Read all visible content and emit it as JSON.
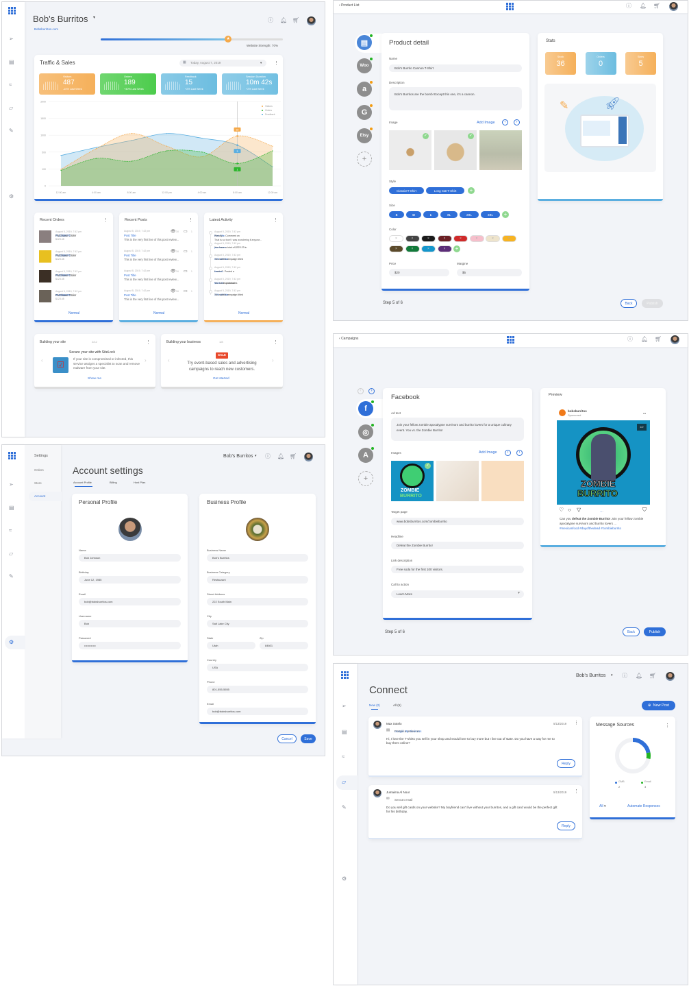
{
  "colors": {
    "accent": "#2f6fd8",
    "visitors": "#f5a94a",
    "orders": "#2db52d",
    "feedback": "#5aaee0",
    "online": "#22b322",
    "pending": "#f39c12"
  },
  "dashboard": {
    "brand": "Bob's Burritos",
    "brand_caret": "▾",
    "site_link": "Bobsburritos.com",
    "website_strength_label": "Website Strength: 70%",
    "website_strength": 0.7,
    "header_icons": [
      "info-icon",
      "bell-icon",
      "cart-icon",
      "avatar"
    ],
    "sidebar_icons": [
      "apps-grid-icon",
      "send-icon",
      "store-icon",
      "analytics-icon",
      "chat-icon",
      "pen-icon",
      "gear-icon"
    ],
    "traffic": {
      "title": "Traffic & Sales",
      "date": "Today, August 7, 2019",
      "stats": [
        {
          "label": "Visitors",
          "value": "487",
          "change": "-10% Last Week",
          "color": "#f5b05a"
        },
        {
          "label": "Orders",
          "value": "189",
          "change": "+40% Last Week",
          "color": "#4ccc4c"
        },
        {
          "label": "Feedback",
          "value": "15",
          "change": "+2% Last Week",
          "color": "#6cbde0"
        },
        {
          "label": "Session Duration",
          "value": "10m 42s",
          "change": "+2% Last Week",
          "color": "#72c0e2"
        }
      ]
    },
    "recent_orders": {
      "title": "Recent Orders",
      "footer": "Normal",
      "items": [
        {
          "date": "August 5, 2019, 7:42 pm",
          "label": "Purchase Order ",
          "order": "#12345678",
          "amount": "$123.45"
        },
        {
          "date": "August 5, 2019, 7:42 pm",
          "label": "Purchase Order ",
          "order": "#12345678",
          "amount": "$123.45"
        },
        {
          "date": "August 5, 2019, 7:42 pm",
          "label": "Purchase Order ",
          "order": "#12345678",
          "amount": "$123.45"
        },
        {
          "date": "August 5, 2019, 7:42 pm",
          "label": "Purchase Order ",
          "order": "#12345678",
          "amount": "$123.45"
        }
      ]
    },
    "recent_posts": {
      "title": "Recent Posts",
      "footer": "Normal",
      "items": [
        {
          "date": "August 5, 2019, 7:42 pm",
          "title": "Post Title",
          "excerpt": "This is the very first line of this post review...",
          "views": "34",
          "comments": "1"
        },
        {
          "date": "August 5, 2019, 7:42 pm",
          "title": "Post Title",
          "excerpt": "This is the very first line of this post review...",
          "views": "34",
          "comments": "1"
        },
        {
          "date": "August 5, 2019, 7:42 pm",
          "title": "Post Title",
          "excerpt": "This is the very first line of this post review...",
          "views": "34",
          "comments": "1"
        },
        {
          "date": "August 5, 2019, 7:42 pm",
          "title": "Post Title",
          "excerpt": "This is the very first line of this post review...",
          "views": "34",
          "comments": "1"
        }
      ]
    },
    "latest_activity": {
      "title": "Latest Activity",
      "footer": "Normal",
      "items": [
        {
          "date": "August 5, 2019, 7:42 pm",
          "text": "Wendy L. Comment on ",
          "link": "Post Title",
          "after": "",
          "extra": "That is so true! I was wondering if anyone..."
        },
        {
          "date": "August 5, 2019, 7:42 pm",
          "text": "You have a total of $323.23 in ",
          "link": "purchases",
          "after": "",
          "extra": ""
        },
        {
          "date": "August 5, 2019, 7:42 pm",
          "text": "You stated campaign titled ",
          "link": "25% off Sale",
          "after": "",
          "extra": ""
        },
        {
          "date": "August 5, 2019, 7:42 pm",
          "text": "Lewis C. Posted a ",
          "link": "#review",
          "after": "",
          "extra": ""
        },
        {
          "date": "August 5, 2019, 7:42 pm",
          "text": "You have a total of ",
          "link": "$323.23",
          "after": " in purchases",
          "extra": ""
        },
        {
          "date": "August 5, 2019, 7:42 pm",
          "text": "You stated campaign titled ",
          "link": "25% off Sale",
          "after": "",
          "extra": ""
        }
      ]
    },
    "building_site": {
      "title": "Building your site",
      "progress": "2/12",
      "heading": "Secure your site with SiteLock",
      "body": "If your site is compromised or infected, this service assigns a specialist to scan and remove malware from your site.",
      "cta": "Show me"
    },
    "building_business": {
      "title": "Building your business",
      "progress": "1/8",
      "badge": "SALE",
      "body": "Try event-based sales and advertising campaigns to reach new customers.",
      "cta": "Get started"
    }
  },
  "chart_data": {
    "type": "area",
    "x": [
      "12:00 am",
      "4:00 am",
      "8:00 am",
      "12:00 pm",
      "4:00 am",
      "8:00 am",
      "12:00 am"
    ],
    "ytick_labels": [
      "0",
      "100",
      "500",
      "1000",
      "1500",
      "2000"
    ],
    "ylim": [
      0,
      2000
    ],
    "grid": true,
    "legend": "top-right",
    "series": [
      {
        "name": "Visitors",
        "color": "#f5a94a",
        "values": [
          390,
          880,
          1240,
          940,
          690,
          1180,
          940
        ]
      },
      {
        "name": "Orders",
        "color": "#2db52d",
        "values": [
          365,
          650,
          585,
          830,
          800,
          530,
          830
        ]
      },
      {
        "name": "Feedback",
        "color": "#5aaee0",
        "values": [
          720,
          910,
          1075,
          1240,
          1130,
          965,
          450
        ]
      }
    ],
    "annotations": [
      {
        "series": "Visitors",
        "label": "32"
      },
      {
        "series": "Feedback",
        "label": "3"
      },
      {
        "series": "Orders",
        "label": "1"
      }
    ]
  },
  "product": {
    "back": "Product List",
    "title": "Product detail",
    "channels": [
      {
        "name": "store",
        "glyph": "▤",
        "status": "online"
      },
      {
        "name": "woocommerce",
        "glyph": "Woo",
        "status": "online"
      },
      {
        "name": "amazon",
        "glyph": "a",
        "status": "pending"
      },
      {
        "name": "google",
        "glyph": "G",
        "status": "pending"
      },
      {
        "name": "etsy",
        "glyph": "Etsy",
        "status": "pending"
      }
    ],
    "name_label": "Name",
    "name_value": "Bob's Burrito Cannon T-Shirt",
    "desc_label": "Description",
    "desc_value": "Bob's Burritos are the bomb! Except this one, it's a cannon.",
    "image_label": "Image",
    "add_image": "Add Image",
    "images": [
      {
        "alt": "t-shirt",
        "checked": true
      },
      {
        "alt": "burrito",
        "checked": true
      },
      {
        "alt": "person",
        "checked": false
      }
    ],
    "style_label": "Style",
    "styles": [
      "Classic T-Shirt",
      "Long Cut T-Shirt"
    ],
    "size_label": "Size",
    "sizes": [
      "S",
      "M",
      "L",
      "XL",
      "2XL",
      "3XL"
    ],
    "color_label": "Color",
    "swatches": [
      "#ffffff",
      "#444444",
      "#1a1a1a",
      "#6b1f24",
      "#d02a2a",
      "#f6bfcb",
      "#eee4cc",
      "#f7b321",
      "#5b4a2a",
      "#127a3a",
      "#1496cc",
      "#5c2d78"
    ],
    "price_label": "Price",
    "price_value": "$20",
    "margin_label": "Margine",
    "margin_value": "$5",
    "step": "Step 5 of 6",
    "back_btn": "Back",
    "publish_btn": "Publish",
    "stats_title": "Stats",
    "stats": [
      {
        "label": "Stock",
        "value": "36",
        "color": "#f5b05a"
      },
      {
        "label": "Orders",
        "value": "0",
        "color": "#6cbde0"
      },
      {
        "label": "Sizes",
        "value": "5",
        "color": "#f5b05a"
      }
    ]
  },
  "account": {
    "brand": "Bob's Burritos",
    "brand_caret": "▾",
    "nav_title": "Settings",
    "nav": [
      "Orders",
      "Store",
      "Account"
    ],
    "title": "Account settings",
    "tabs": [
      "Account Profile",
      "Billing",
      "Host Plan"
    ],
    "personal": {
      "title": "Personal Profile",
      "fields": [
        {
          "label": "Name",
          "value": "Bob Johnson"
        },
        {
          "label": "Birthday",
          "value": "June 12, 1985"
        },
        {
          "label": "Email",
          "value": "bob@bobsburritos.com"
        },
        {
          "label": "Username",
          "value": "Bob"
        },
        {
          "label": "Password",
          "value": "••••••••••••"
        }
      ]
    },
    "business": {
      "title": "Business Profile",
      "fields": [
        {
          "label": "Business Name",
          "value": "Bob's Burritos"
        },
        {
          "label": "Business Category",
          "value": "Restaurant"
        },
        {
          "label": "Street Address",
          "value": "222 South Main"
        },
        {
          "label": "City",
          "value": "Salt Lake City"
        }
      ],
      "state_label": "State",
      "state_value": "Utah",
      "zip_label": "Zip",
      "zip_value": "84601",
      "fields2": [
        {
          "label": "Country",
          "value": "USA"
        },
        {
          "label": "Phone",
          "value": "801-555-5555"
        },
        {
          "label": "Email",
          "value": "bob@bobsburritos.com"
        }
      ]
    },
    "cancel": "Cancel",
    "save": "Save"
  },
  "campaign": {
    "back": "Campaigns",
    "title": "Facebook",
    "channels": [
      {
        "name": "facebook",
        "glyph": "f",
        "color": "#2f6fd8"
      },
      {
        "name": "instagram",
        "glyph": "◎",
        "color": "#8e8e8e"
      },
      {
        "name": "google-ads",
        "glyph": "A",
        "color": "#8e8e8e"
      }
    ],
    "ad_text_label": "Ad text",
    "ad_text": "Join your fellow zombie apocalypse survivors and burrito lovers for a unique culinary event. You vs. the Zombie Burrito!",
    "images_label": "Images",
    "add_image": "Add Image",
    "target_label": "Target page",
    "target_value": "www.bobsburritos.com/zombieburrito",
    "headline_label": "Headline",
    "headline_value": "Defeat the Zombie Burrito!",
    "link_desc_label": "Link description",
    "link_desc_value": "Free soda for the first 100 visitors.",
    "cta_label": "Call to action",
    "cta_value": "Learn More",
    "step": "Step 5 of 6",
    "back_btn": "Back",
    "publish_btn": "Publish",
    "preview": {
      "title": "Preview",
      "account": "bobsburritos",
      "sponsored": "Sponsored",
      "more": "•••",
      "counter": "1/2",
      "logo_line1": "ZOMBIE",
      "logo_line2": "BURRITO",
      "caption_pre": "Can you ",
      "caption_bold": "defeat the Zombie Burrito!",
      "caption_post": " Join your fellow zombie apocalypse survivors and burrito lovers ...",
      "hashtags": "#mexicanfood #dayofthedead #zombieburrito"
    }
  },
  "connect": {
    "brand": "Bob's Burritos",
    "brand_caret": "▾",
    "title": "Connect",
    "tabs": [
      "New (2)",
      "All (5)"
    ],
    "new_post": "New Post",
    "messages": [
      {
        "name": "Max Sotelo",
        "date": "5/13/2019",
        "action": "Posted a review on ",
        "action_link": "Google My Business",
        "body": "Hi, I love the T-shirts you sell in your shop and would love to buy more but I live out of state. Do you have a way for me to buy them online?",
        "reply": "Reply"
      },
      {
        "name": "Jumaima Al Nour",
        "date": "5/13/2019",
        "action": "Sent an email",
        "action_link": "",
        "body": "Do you sell gift cards on your website? My boyfriend can't live without your burritos, and a gift card would be the perfect gift for his birthday.",
        "reply": "Reply"
      }
    ],
    "sources": {
      "title": "Message Sources",
      "items": [
        {
          "label": "GMB",
          "count": "2",
          "color": "#2f6fd8"
        },
        {
          "label": "Email",
          "count": "3",
          "color": "#22b322"
        }
      ],
      "filter": "All",
      "automate": "Automate Responses"
    }
  }
}
